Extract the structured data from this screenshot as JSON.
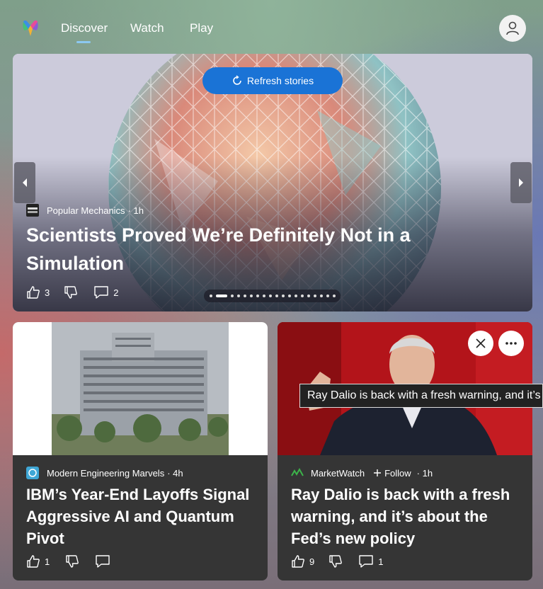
{
  "nav": {
    "tabs": [
      {
        "label": "Discover",
        "active": true
      },
      {
        "label": "Watch"
      },
      {
        "label": "Play"
      }
    ]
  },
  "hero": {
    "refresh_label": "Refresh stories",
    "source": "Popular Mechanics",
    "time": "· 1h",
    "title": "Scientists Proved We’re Definitely Not in a Simulation",
    "likes": "3",
    "comments": "2",
    "slides_total": 19,
    "slide_active": 2
  },
  "cards": [
    {
      "source": "Modern Engineering Marvels",
      "time": "· 4h",
      "title": "IBM’s Year-End Layoffs Signal Aggressive AI and Quantum Pivot",
      "likes": "1",
      "comments": ""
    },
    {
      "source": "MarketWatch",
      "follow_label": "Follow",
      "time": "· 1h",
      "title": "Ray Dalio is back with a fresh warning, and it’s about the Fed’s new policy",
      "likes": "9",
      "comments": "1"
    }
  ],
  "tooltip": {
    "text": "Ray Dalio is back with a fresh warning, and it’s about the Fed’s new policy"
  },
  "colors": {
    "accent": "#1a73d6",
    "card_bg": "#353535",
    "tab_underline": "#8cc8f0"
  }
}
